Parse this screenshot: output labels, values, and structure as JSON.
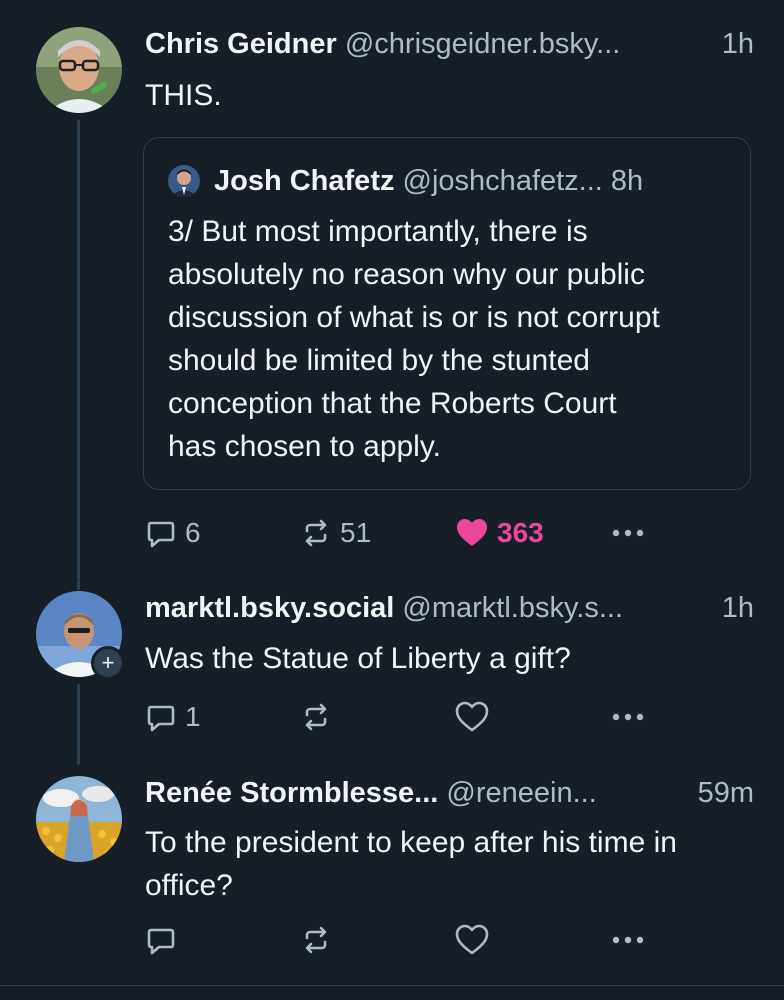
{
  "posts": [
    {
      "name": "Chris Geidner",
      "handle": "@chrisgeidner.bsky...",
      "time": "1h",
      "text": "THIS.",
      "quote": {
        "name": "Josh Chafetz",
        "handle": "@joshchafetz...",
        "time": "8h",
        "text": "3/ But most importantly, there is absolutely no reason why our public discussion of what is or is not corrupt should be limited by the stunted conception that the Roberts Court has chosen to apply."
      },
      "reply_count": "6",
      "repost_count": "51",
      "like_count": "363"
    },
    {
      "name": "marktl.bsky.social",
      "handle": "@marktl.bsky.s...",
      "time": "1h",
      "text": "Was the Statue of Liberty a gift?",
      "reply_count": "1",
      "follow_badge": "+"
    },
    {
      "name": "Renée Stormblesse...",
      "handle": "@reneein...",
      "time": "59m",
      "text": "To the president to keep after his time in office?"
    }
  ],
  "colors": {
    "background": "#161e27",
    "muted": "#aebbc9",
    "like": "#ec4899",
    "border": "#2e4052"
  },
  "icons": [
    "reply-icon",
    "repost-icon",
    "like-icon",
    "more-icon"
  ]
}
